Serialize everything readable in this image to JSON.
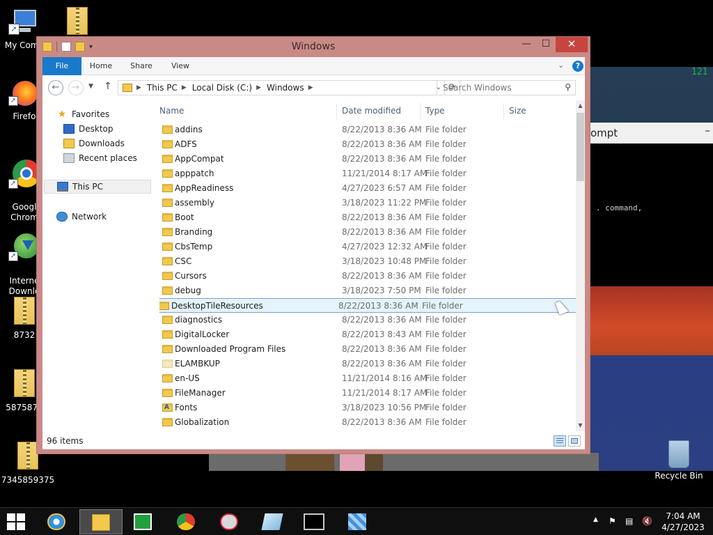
{
  "desktop": {
    "icons": [
      {
        "label": "My Comp",
        "kind": "computer"
      },
      {
        "label": "",
        "kind": "zip"
      },
      {
        "label": "Firefo",
        "kind": "firefox"
      },
      {
        "label": "Googl\nChrom",
        "kind": "chrome"
      },
      {
        "label": "Interne\nDownlo",
        "kind": "idm"
      },
      {
        "label": "8732",
        "kind": "zip"
      },
      {
        "label": "5875875",
        "kind": "zip"
      },
      {
        "label": "7345859375",
        "kind": "zip"
      }
    ],
    "recycle_bin": "Recycle Bin",
    "cmd_window": {
      "title_fragment": "ompt",
      "text_fragment": ". command,",
      "corner_number": "121"
    }
  },
  "window": {
    "title": "Windows",
    "controls": {
      "minimize": "—",
      "maximize": "☐",
      "close": "✕"
    },
    "ribbon": {
      "tabs": [
        "File",
        "Home",
        "Share",
        "View"
      ]
    },
    "address": {
      "crumbs": [
        "This PC",
        "Local Disk (C:)",
        "Windows"
      ],
      "search_placeholder": "Search Windows"
    },
    "nav": {
      "favorites": "Favorites",
      "desktop": "Desktop",
      "downloads": "Downloads",
      "recent": "Recent places",
      "this_pc": "This PC",
      "network": "Network"
    },
    "columns": {
      "name": "Name",
      "date": "Date modified",
      "type": "Type",
      "size": "Size"
    },
    "files": [
      {
        "name": "addins",
        "date": "8/22/2013 8:36 AM",
        "type": "File folder"
      },
      {
        "name": "ADFS",
        "date": "8/22/2013 8:36 AM",
        "type": "File folder"
      },
      {
        "name": "AppCompat",
        "date": "8/22/2013 8:36 AM",
        "type": "File folder"
      },
      {
        "name": "apppatch",
        "date": "11/21/2014 8:17 AM",
        "type": "File folder"
      },
      {
        "name": "AppReadiness",
        "date": "4/27/2023 6:57 AM",
        "type": "File folder"
      },
      {
        "name": "assembly",
        "date": "3/18/2023 11:22 PM",
        "type": "File folder"
      },
      {
        "name": "Boot",
        "date": "8/22/2013 8:36 AM",
        "type": "File folder"
      },
      {
        "name": "Branding",
        "date": "8/22/2013 8:36 AM",
        "type": "File folder"
      },
      {
        "name": "CbsTemp",
        "date": "4/27/2023 12:32 AM",
        "type": "File folder"
      },
      {
        "name": "CSC",
        "date": "3/18/2023 10:48 PM",
        "type": "File folder"
      },
      {
        "name": "Cursors",
        "date": "8/22/2013 8:36 AM",
        "type": "File folder"
      },
      {
        "name": "debug",
        "date": "3/18/2023 7:50 PM",
        "type": "File folder"
      },
      {
        "name": "DesktopTileResources",
        "date": "8/22/2013 8:36 AM",
        "type": "File folder",
        "selected": true
      },
      {
        "name": "diagnostics",
        "date": "8/22/2013 8:36 AM",
        "type": "File folder"
      },
      {
        "name": "DigitalLocker",
        "date": "8/22/2013 8:43 AM",
        "type": "File folder"
      },
      {
        "name": "Downloaded Program Files",
        "date": "8/22/2013 8:36 AM",
        "type": "File folder"
      },
      {
        "name": "ELAMBKUP",
        "date": "8/22/2013 8:36 AM",
        "type": "File folder",
        "pale": true
      },
      {
        "name": "en-US",
        "date": "11/21/2014 8:16 AM",
        "type": "File folder"
      },
      {
        "name": "FileManager",
        "date": "11/21/2014 8:17 AM",
        "type": "File folder"
      },
      {
        "name": "Fonts",
        "date": "3/18/2023 10:56 PM",
        "type": "File folder",
        "fonts": true
      },
      {
        "name": "Globalization",
        "date": "8/22/2013 8:36 AM",
        "type": "File folder"
      }
    ],
    "status": {
      "item_count": "96 items"
    }
  },
  "taskbar": {
    "clock_time": "7:04 AM",
    "clock_date": "4/27/2023"
  },
  "colors": {
    "title_frame": "#c98a86",
    "file_tab": "#1979ca",
    "close_button": "#c7453e",
    "selection": "#e5f3fb"
  }
}
